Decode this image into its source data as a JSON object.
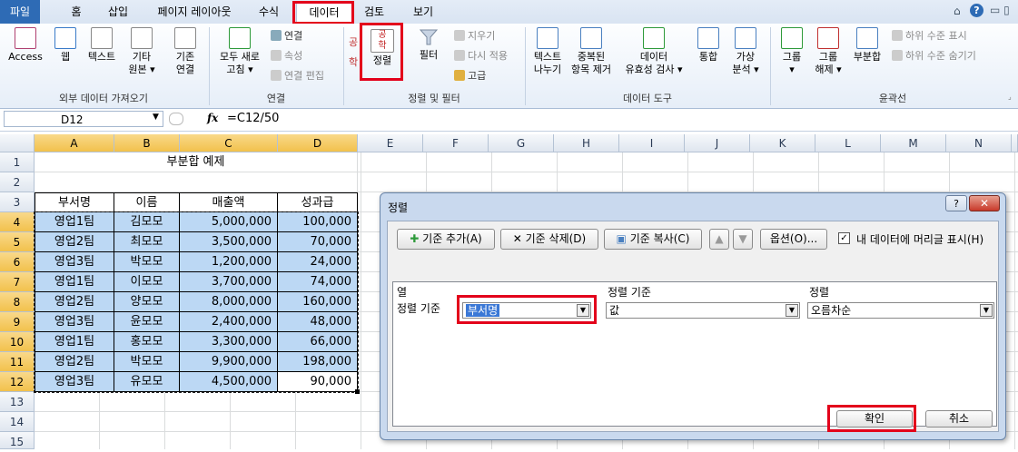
{
  "tabs": [
    "파일",
    "홈",
    "삽입",
    "페이지 레이아웃",
    "수식",
    "데이터",
    "검토",
    "보기"
  ],
  "ribbon": {
    "ext": {
      "access": "Access",
      "web": "웹",
      "text": "텍스트",
      "other": "기타",
      "other2": "원본 ▾",
      "existing": "기존",
      "existing2": "연결",
      "label": "외부 데이터 가져오기"
    },
    "conn": {
      "refresh": "모두 새로",
      "refresh2": "고침 ▾",
      "connections": "연결",
      "properties": "속성",
      "edit_links": "연결 편집",
      "label": "연결"
    },
    "sort": {
      "sort": "정렬",
      "filter": "필터",
      "clear": "지우기",
      "reapply": "다시 적용",
      "advanced": "고급",
      "label": "정렬 및 필터"
    },
    "tools": {
      "text_cols": "텍스트",
      "text_cols2": "나누기",
      "dup": "중복된",
      "dup2": "항목 제거",
      "valid": "데이터",
      "valid2": "유효성 검사 ▾",
      "consol": "통합",
      "whatif": "가상",
      "whatif2": "분석 ▾",
      "label": "데이터 도구"
    },
    "outline": {
      "group": "그룹",
      "ungroup": "그룹",
      "ungroup2": "해제 ▾",
      "subtotal": "부분합",
      "show": "하위 수준 표시",
      "hide": "하위 수준 숨기기",
      "label": "윤곽선"
    }
  },
  "formula_bar": {
    "name_box": "D12",
    "fx": "fx",
    "formula": "=C12/50"
  },
  "columns": [
    "A",
    "B",
    "C",
    "D",
    "E",
    "F",
    "G",
    "H",
    "I",
    "J",
    "K",
    "L",
    "M",
    "N"
  ],
  "rows": [
    "1",
    "2",
    "3",
    "4",
    "5",
    "6",
    "7",
    "8",
    "9",
    "10",
    "11",
    "12",
    "13",
    "14",
    "15"
  ],
  "sheet": {
    "title": "부분합 예제",
    "headers": [
      "부서명",
      "이름",
      "매출액",
      "성과급"
    ],
    "data": [
      [
        "영업1팀",
        "김모모",
        "5,000,000",
        "100,000"
      ],
      [
        "영업2팀",
        "최모모",
        "3,500,000",
        "70,000"
      ],
      [
        "영업3팀",
        "박모모",
        "1,200,000",
        "24,000"
      ],
      [
        "영업1팀",
        "이모모",
        "3,700,000",
        "74,000"
      ],
      [
        "영업2팀",
        "양모모",
        "8,000,000",
        "160,000"
      ],
      [
        "영업3팀",
        "윤모모",
        "2,400,000",
        "48,000"
      ],
      [
        "영업1팀",
        "홍모모",
        "3,300,000",
        "66,000"
      ],
      [
        "영업2팀",
        "박모모",
        "9,900,000",
        "198,000"
      ],
      [
        "영업3팀",
        "유모모",
        "4,500,000",
        "90,000"
      ]
    ]
  },
  "dialog": {
    "title": "정렬",
    "add": "기준 추가(A)",
    "delete": "기준 삭제(D)",
    "copy": "기준 복사(C)",
    "options": "옵션(O)...",
    "header_check": "내 데이터에 머리글 표시(H)",
    "col_header": "열",
    "sorton_header": "정렬 기준",
    "order_header": "정렬",
    "row_label": "정렬 기준",
    "column_value": "부서명",
    "sorton_value": "값",
    "order_value": "오름차순",
    "ok": "확인",
    "cancel": "취소"
  },
  "colors": {
    "accent_red": "#e3001b",
    "selection_blue": "#bcd8f4",
    "file_tab": "#2e6bb5"
  }
}
